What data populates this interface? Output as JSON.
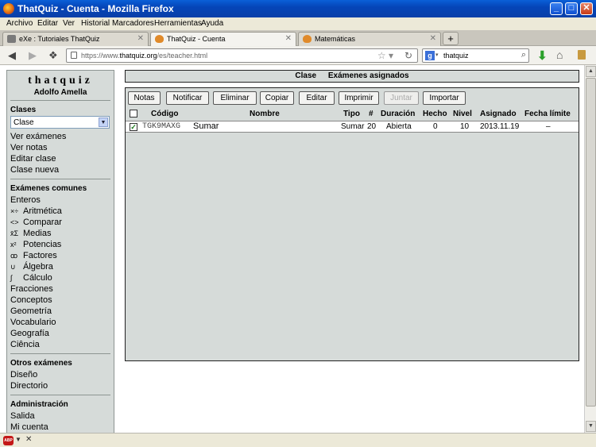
{
  "window": {
    "title": "ThatQuiz - Cuenta - Mozilla Firefox",
    "min": "_",
    "max": "□",
    "close": "✕"
  },
  "menu": [
    "Archivo",
    "Editar",
    "Ver",
    "Historial",
    "Marcadores",
    "Herramientas",
    "Ayuda"
  ],
  "tabs": [
    {
      "label": "eXe : Tutoriales ThatQuiz",
      "icon": "exe-icon",
      "active": false
    },
    {
      "label": "ThatQuiz - Cuenta",
      "icon": "thatquiz-icon",
      "active": true
    },
    {
      "label": "Matemáticas",
      "icon": "thatquiz-icon",
      "active": false
    }
  ],
  "new_tab": "+",
  "nav": {
    "url_prefix": "https://www.",
    "url_host": "thatquiz.org",
    "url_path": "/es/teacher.html",
    "search_value": "thatquiz",
    "search_engine": "g"
  },
  "sidebar": {
    "brand": "thatquiz",
    "teacher": "Adolfo Amella",
    "classes_head": "Clases",
    "class_select": "Clase",
    "class_links": [
      "Ver exámenes",
      "Ver notas",
      "Editar clase",
      "Clase nueva"
    ],
    "common_head": "Exámenes comunes",
    "common_links": [
      {
        "glyph": "",
        "label": "Enteros"
      },
      {
        "glyph": "×÷",
        "label": "Aritmética"
      },
      {
        "glyph": "<>",
        "label": "Comparar"
      },
      {
        "glyph": "x̄Σ",
        "label": "Medias"
      },
      {
        "glyph": "x²",
        "label": "Potencias"
      },
      {
        "glyph": "ꝏ",
        "label": "Factores"
      },
      {
        "glyph": "∪",
        "label": "Álgebra"
      },
      {
        "glyph": "∫",
        "label": "Cálculo"
      },
      {
        "glyph": "",
        "label": "Fracciones"
      },
      {
        "glyph": "",
        "label": "Conceptos"
      },
      {
        "glyph": "",
        "label": "Geometría"
      },
      {
        "glyph": "",
        "label": "Vocabulario"
      },
      {
        "glyph": "",
        "label": "Geografía"
      },
      {
        "glyph": "",
        "label": "Ciência"
      }
    ],
    "other_head": "Otros exámenes",
    "other_links": [
      "Diseño",
      "Directorio"
    ],
    "admin_head": "Administración",
    "admin_links": [
      "Salida",
      "Mi cuenta"
    ]
  },
  "main": {
    "header_left": "Clase",
    "header_right": "Exámenes asignados",
    "buttons": [
      {
        "label": "Notas",
        "enabled": true
      },
      {
        "label": "Notificar",
        "enabled": true
      },
      {
        "label": "Eliminar",
        "enabled": true
      },
      {
        "label": "Copiar",
        "enabled": true
      },
      {
        "label": "Editar",
        "enabled": true
      },
      {
        "label": "Imprimir",
        "enabled": true
      },
      {
        "label": "Juntar",
        "enabled": false
      },
      {
        "label": "Importar",
        "enabled": true
      }
    ],
    "columns": [
      "Código",
      "Nombre",
      "Tipo",
      "#",
      "Duración",
      "Hecho",
      "Nivel",
      "Asignado",
      "Fecha límite"
    ],
    "rows": [
      {
        "checked": true,
        "code": "TGK9MAXG",
        "name": "Sumar",
        "type": "Sumar",
        "count": "20",
        "duration": "Abierta",
        "done": "0",
        "level": "10",
        "assigned": "2013.11.19",
        "deadline": "–"
      }
    ]
  },
  "status": {
    "abp": "ABP",
    "arrow": "▼",
    "close": "✕"
  }
}
